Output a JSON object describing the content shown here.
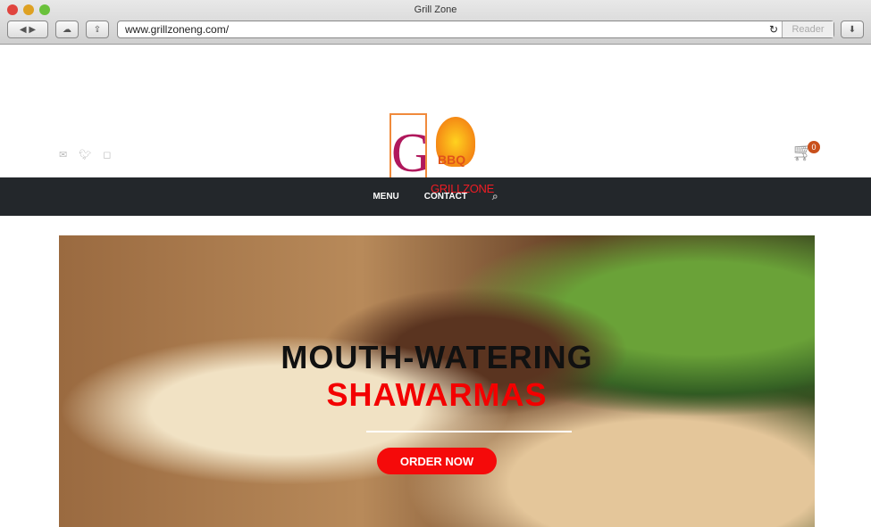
{
  "browser": {
    "title": "Grill Zone",
    "url": "www.grillzoneng.com/",
    "reader_label": "Reader"
  },
  "logo": {
    "letter": "G",
    "badge": "BBQ",
    "name": "GRILLZONE"
  },
  "cart": {
    "count": "0"
  },
  "nav": {
    "items": [
      "MENU",
      "CONTACT"
    ]
  },
  "hero": {
    "line1": "MOUTH-WATERING",
    "line2": "SHAWARMAS",
    "cta": "ORDER NOW"
  }
}
